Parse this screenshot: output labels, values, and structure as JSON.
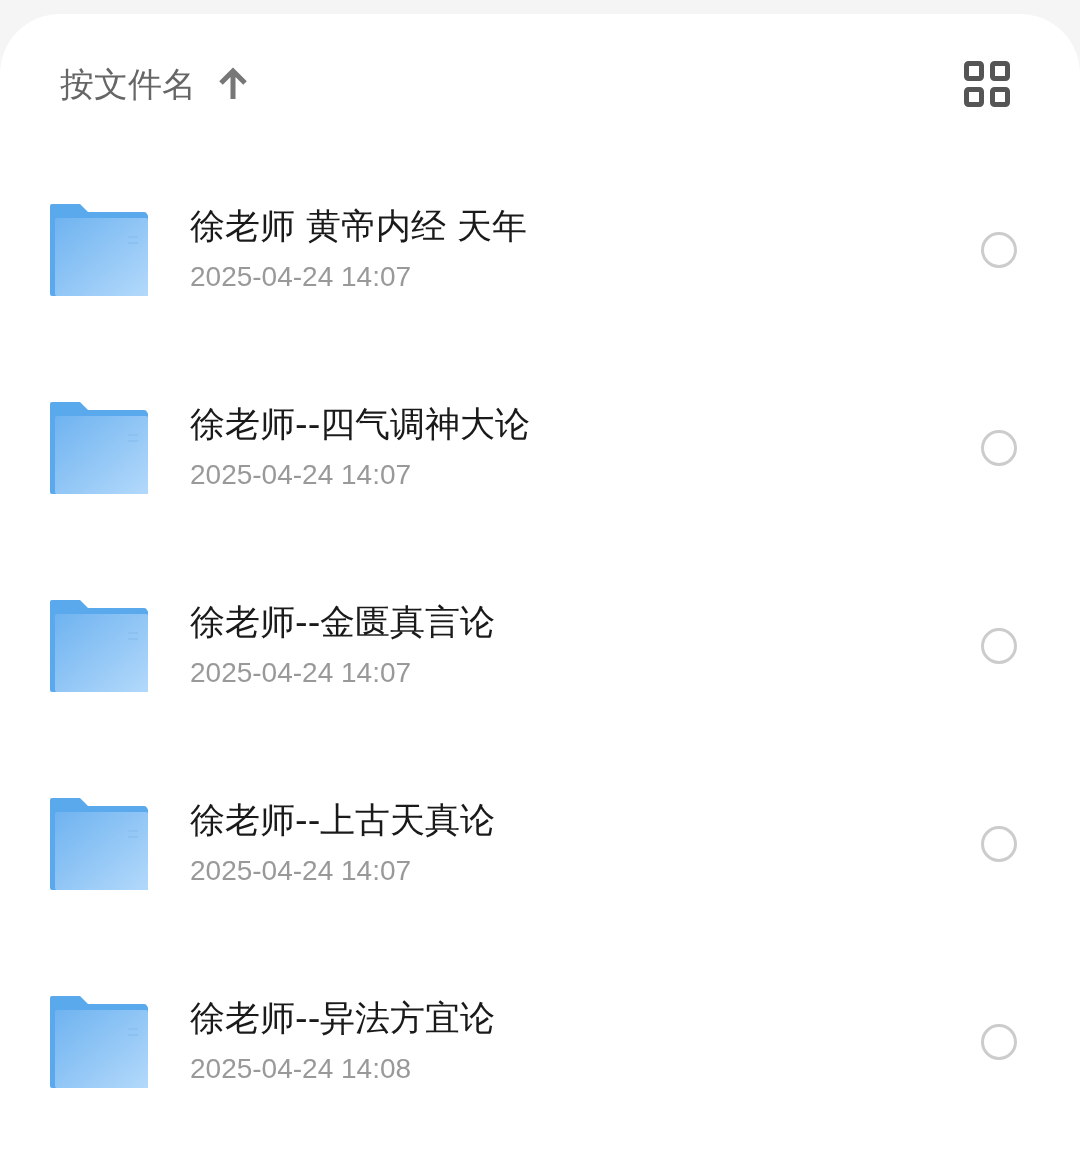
{
  "sort": {
    "label": "按文件名"
  },
  "files": [
    {
      "name": "徐老师 黄帝内经 天年",
      "modified": "2025-04-24 14:07",
      "selected": false
    },
    {
      "name": "徐老师--四气调神大论",
      "modified": "2025-04-24 14:07",
      "selected": false
    },
    {
      "name": "徐老师--金匮真言论",
      "modified": "2025-04-24 14:07",
      "selected": false
    },
    {
      "name": "徐老师--上古天真论",
      "modified": "2025-04-24 14:07",
      "selected": false
    },
    {
      "name": "徐老师--异法方宜论",
      "modified": "2025-04-24 14:08",
      "selected": false
    }
  ]
}
